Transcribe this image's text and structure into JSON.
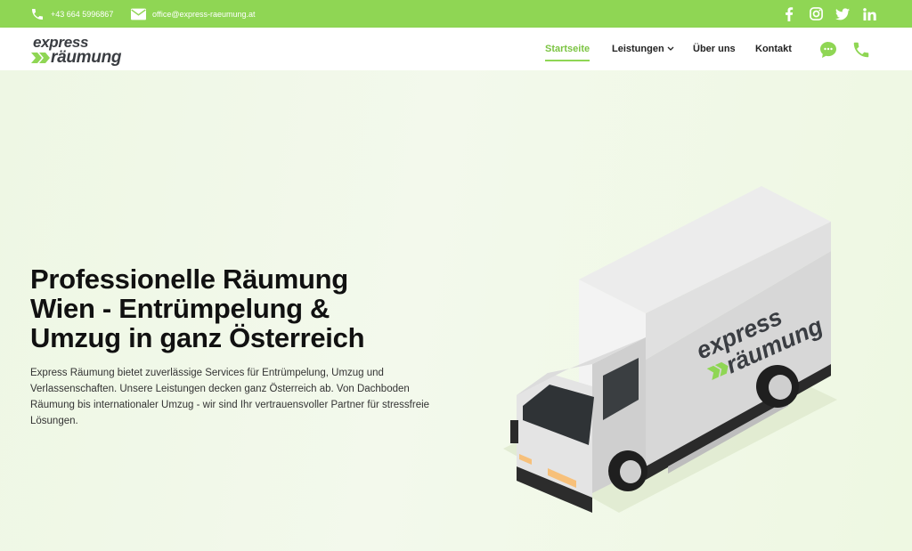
{
  "topbar": {
    "phone": "+43 664 5996867",
    "email": "office@express-raeumung.at",
    "social": [
      "facebook-icon",
      "instagram-icon",
      "twitter-icon",
      "linkedin-icon"
    ]
  },
  "logo": {
    "line1": "express",
    "line2": "räumung"
  },
  "nav": {
    "home": "Startseite",
    "services": "Leistungen",
    "about": "Über uns",
    "contact": "Kontakt"
  },
  "hero": {
    "title": "Professionelle Räumung Wien - Entrümpelung & Umzug in ganz Österreich",
    "text": "Express Räumung bietet zuverlässige Services für Entrümpelung, Umzug und Verlassenschaften. Unsere Leistungen decken ganz Österreich ab. Von Dachboden Räumung bis internationaler Umzug - wir sind Ihr vertrauensvoller Partner für stressfreie Lösungen."
  },
  "truck_logo": {
    "line1": "express",
    "line2": "räumung"
  },
  "colors": {
    "accent": "#8fd654",
    "accent_dark": "#7cc443",
    "text": "#111111"
  }
}
